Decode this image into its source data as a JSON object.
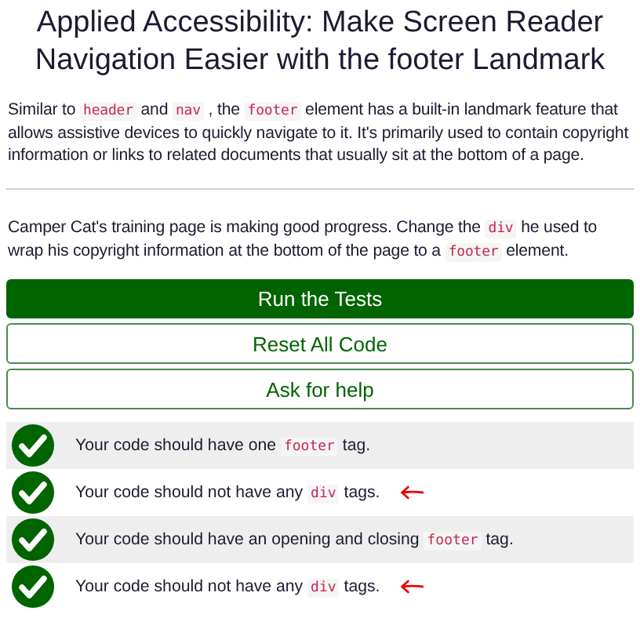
{
  "title": "Applied Accessibility: Make Screen Reader Navigation Easier with the footer Landmark",
  "description": [
    {
      "kind": "text",
      "text": "Similar to "
    },
    {
      "kind": "code",
      "text": "header"
    },
    {
      "kind": "text",
      "text": " and "
    },
    {
      "kind": "code",
      "text": "nav"
    },
    {
      "kind": "text",
      "text": " , the "
    },
    {
      "kind": "code",
      "text": "footer"
    },
    {
      "kind": "text",
      "text": " element has a built-in landmark feature that allows assistive devices to quickly navigate to it. It's primarily used to contain copyright information or links to related documents that usually sit at the bottom of a page."
    }
  ],
  "instructions": [
    {
      "kind": "text",
      "text": "Camper Cat's training page is making good progress. Change the "
    },
    {
      "kind": "code",
      "text": "div"
    },
    {
      "kind": "text",
      "text": " he used to wrap his copyright information at the bottom of the page to a "
    },
    {
      "kind": "code",
      "text": "footer"
    },
    {
      "kind": "text",
      "text": " element."
    }
  ],
  "buttons": [
    {
      "label": "Run the Tests",
      "kind": "primary"
    },
    {
      "label": "Reset All Code",
      "kind": "outline"
    },
    {
      "label": "Ask for help",
      "kind": "outline"
    }
  ],
  "tests": [
    {
      "passed": true,
      "marked": false,
      "text": [
        {
          "kind": "text",
          "text": "Your code should have one "
        },
        {
          "kind": "code",
          "text": "footer"
        },
        {
          "kind": "text",
          "text": " tag."
        }
      ]
    },
    {
      "passed": true,
      "marked": true,
      "text": [
        {
          "kind": "text",
          "text": "Your code should not have any "
        },
        {
          "kind": "code",
          "text": "div"
        },
        {
          "kind": "text",
          "text": " tags."
        }
      ]
    },
    {
      "passed": true,
      "marked": false,
      "text": [
        {
          "kind": "text",
          "text": "Your code should have an opening and closing "
        },
        {
          "kind": "code",
          "text": "footer"
        },
        {
          "kind": "text",
          "text": " tag."
        }
      ]
    },
    {
      "passed": true,
      "marked": true,
      "text": [
        {
          "kind": "text",
          "text": "Your code should not have any "
        },
        {
          "kind": "code",
          "text": "div"
        },
        {
          "kind": "text",
          "text": " tags."
        }
      ]
    }
  ]
}
